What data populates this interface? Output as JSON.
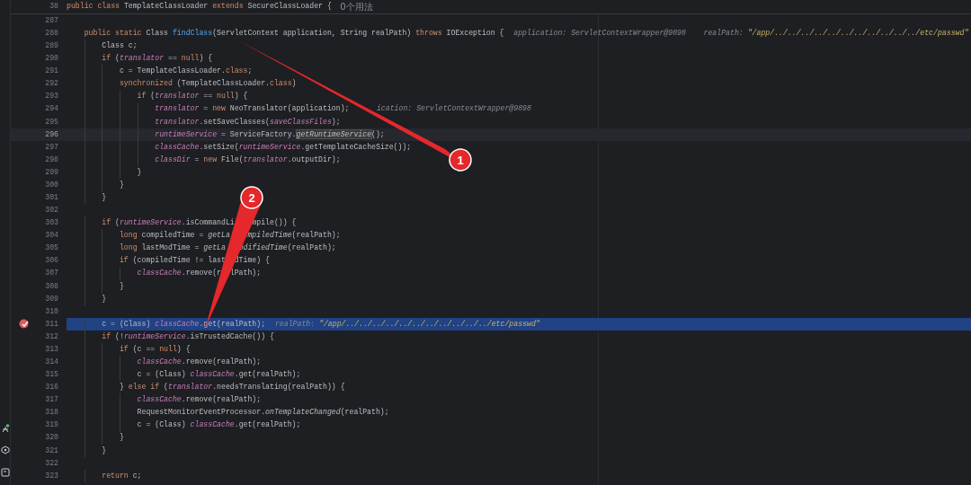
{
  "header": {
    "line": "38",
    "code": [
      {
        "kind": "keyword",
        "text": "public class "
      },
      {
        "kind": "plain",
        "text": "TemplateClassLoader "
      },
      {
        "kind": "keyword",
        "text": "extends "
      },
      {
        "kind": "plain",
        "text": "SecureClassLoader {"
      }
    ],
    "usages": "0个用法"
  },
  "lines": [
    {
      "n": "287",
      "kind": "code",
      "breakpoint": false
    },
    {
      "n": "288",
      "kind": "code",
      "breakpoint": false,
      "code": [
        {
          "kind": "keyword",
          "text": "    public static "
        },
        {
          "kind": "plain",
          "text": "Class "
        },
        {
          "kind": "declaration",
          "text": "findClass"
        },
        {
          "kind": "plain",
          "text": "(ServletContext application, String realPath) "
        },
        {
          "kind": "keyword",
          "text": "throws "
        },
        {
          "kind": "plain",
          "text": "IOException {"
        }
      ],
      "hints": [
        [
          {
            "kind": "hint",
            "text": "application: "
          },
          {
            "kind": "hint",
            "text": "ServletContextWrapper@9898"
          }
        ],
        [
          {
            "kind": "hint",
            "text": "realPath: "
          },
          {
            "kind": "hint-string",
            "text": "\"/app/../../../../../../../../../../../etc/passwd\""
          }
        ]
      ]
    },
    {
      "n": "289",
      "kind": "code",
      "breakpoint": false,
      "code": [
        {
          "kind": "plain",
          "text": "        Class c;"
        }
      ]
    },
    {
      "n": "290",
      "kind": "code",
      "breakpoint": false,
      "code": [
        {
          "kind": "keyword",
          "text": "        if "
        },
        {
          "kind": "plain",
          "text": "("
        },
        {
          "kind": "field",
          "text": "translator"
        },
        {
          "kind": "plain",
          "text": " == "
        },
        {
          "kind": "keyword",
          "text": "null"
        },
        {
          "kind": "plain",
          "text": ") {"
        }
      ]
    },
    {
      "n": "291",
      "kind": "code",
      "breakpoint": false,
      "code": [
        {
          "kind": "plain",
          "text": "            c = TemplateClassLoader."
        },
        {
          "kind": "keyword",
          "text": "class"
        },
        {
          "kind": "plain",
          "text": ";"
        }
      ]
    },
    {
      "n": "292",
      "kind": "code",
      "breakpoint": false,
      "code": [
        {
          "kind": "keyword",
          "text": "            synchronized "
        },
        {
          "kind": "plain",
          "text": "(TemplateClassLoader."
        },
        {
          "kind": "keyword",
          "text": "class"
        },
        {
          "kind": "plain",
          "text": ")"
        }
      ]
    },
    {
      "n": "293",
      "kind": "code",
      "breakpoint": false,
      "code": [
        {
          "kind": "keyword",
          "text": "                if "
        },
        {
          "kind": "plain",
          "text": "("
        },
        {
          "kind": "field",
          "text": "translator"
        },
        {
          "kind": "plain",
          "text": " == "
        },
        {
          "kind": "keyword",
          "text": "null"
        },
        {
          "kind": "plain",
          "text": ") {"
        }
      ]
    },
    {
      "n": "294",
      "kind": "code",
      "breakpoint": false,
      "code": [
        {
          "kind": "field",
          "text": "                    translator"
        },
        {
          "kind": "plain",
          "text": " = "
        },
        {
          "kind": "keyword",
          "text": "new "
        },
        {
          "kind": "plain",
          "text": "NeoTranslator(application);"
        }
      ],
      "hints": [
        [
          {
            "kind": "covered"
          },
          {
            "kind": "hint",
            "text": "ication: "
          },
          {
            "kind": "hint",
            "text": "ServletContextWrapper@9898"
          }
        ]
      ]
    },
    {
      "n": "295",
      "kind": "code",
      "breakpoint": false,
      "code": [
        {
          "kind": "field",
          "text": "                    translator"
        },
        {
          "kind": "plain",
          "text": ".setSaveClasses("
        },
        {
          "kind": "field",
          "text": "saveClassFiles"
        },
        {
          "kind": "plain",
          "text": ");"
        }
      ]
    },
    {
      "n": "296",
      "kind": "caret",
      "breakpoint": false,
      "code": [
        {
          "kind": "field",
          "text": "                    runtimeService"
        },
        {
          "kind": "plain",
          "text": " = ServiceFactory."
        },
        {
          "kind": "usage",
          "text": "getRuntimeService"
        },
        {
          "kind": "plain",
          "text": "();"
        }
      ]
    },
    {
      "n": "297",
      "kind": "code",
      "breakpoint": false,
      "code": [
        {
          "kind": "field",
          "text": "                    classCache"
        },
        {
          "kind": "plain",
          "text": ".setSize("
        },
        {
          "kind": "field",
          "text": "runtimeService"
        },
        {
          "kind": "plain",
          "text": ".getTemplateCacheSize());"
        }
      ]
    },
    {
      "n": "298",
      "kind": "code",
      "breakpoint": false,
      "code": [
        {
          "kind": "field",
          "text": "                    classDir"
        },
        {
          "kind": "plain",
          "text": " = "
        },
        {
          "kind": "keyword",
          "text": "new "
        },
        {
          "kind": "plain",
          "text": "File("
        },
        {
          "kind": "field",
          "text": "translator"
        },
        {
          "kind": "plain",
          "text": ".outputDir);"
        }
      ]
    },
    {
      "n": "299",
      "kind": "code",
      "breakpoint": false,
      "code": [
        {
          "kind": "plain",
          "text": "                }"
        }
      ]
    },
    {
      "n": "300",
      "kind": "code",
      "breakpoint": false,
      "code": [
        {
          "kind": "plain",
          "text": "            }"
        }
      ]
    },
    {
      "n": "301",
      "kind": "code",
      "breakpoint": false,
      "code": [
        {
          "kind": "plain",
          "text": "        }"
        }
      ]
    },
    {
      "n": "302",
      "kind": "code",
      "breakpoint": false
    },
    {
      "n": "303",
      "kind": "code",
      "breakpoint": false,
      "code": [
        {
          "kind": "keyword",
          "text": "        if "
        },
        {
          "kind": "plain",
          "text": "("
        },
        {
          "kind": "field",
          "text": "runtimeService"
        },
        {
          "kind": "plain",
          "text": ".isCommandLi"
        },
        {
          "kind": "covered"
        },
        {
          "kind": "plain",
          "text": "mpile()) {"
        }
      ]
    },
    {
      "n": "304",
      "kind": "code",
      "breakpoint": false,
      "code": [
        {
          "kind": "keyword",
          "text": "            long "
        },
        {
          "kind": "plain",
          "text": "compiledTime = "
        },
        {
          "kind": "static-call",
          "text": "getLa"
        },
        {
          "kind": "covered"
        },
        {
          "kind": "static-call",
          "text": "mpiledTime"
        },
        {
          "kind": "plain",
          "text": "(realPath);"
        }
      ]
    },
    {
      "n": "305",
      "kind": "code",
      "breakpoint": false,
      "code": [
        {
          "kind": "keyword",
          "text": "            long "
        },
        {
          "kind": "plain",
          "text": "lastModTime = "
        },
        {
          "kind": "static-call",
          "text": "getLa"
        },
        {
          "kind": "covered"
        },
        {
          "kind": "static-call",
          "text": "odifiedTime"
        },
        {
          "kind": "plain",
          "text": "(realPath);"
        }
      ]
    },
    {
      "n": "306",
      "kind": "code",
      "breakpoint": false,
      "code": [
        {
          "kind": "keyword",
          "text": "            if "
        },
        {
          "kind": "plain",
          "text": "(compiledTime != last"
        },
        {
          "kind": "covered"
        },
        {
          "kind": "plain",
          "text": "dTime) {"
        }
      ]
    },
    {
      "n": "307",
      "kind": "code",
      "breakpoint": false,
      "code": [
        {
          "kind": "field",
          "text": "                classCache"
        },
        {
          "kind": "plain",
          "text": ".remove(r"
        },
        {
          "kind": "covered"
        },
        {
          "kind": "plain",
          "text": "lPath);"
        }
      ]
    },
    {
      "n": "308",
      "kind": "code",
      "breakpoint": false,
      "code": [
        {
          "kind": "plain",
          "text": "            }"
        }
      ]
    },
    {
      "n": "309",
      "kind": "code",
      "breakpoint": false,
      "code": [
        {
          "kind": "plain",
          "text": "        }"
        }
      ]
    },
    {
      "n": "310",
      "kind": "code",
      "breakpoint": false
    },
    {
      "n": "311",
      "kind": "execution",
      "breakpoint": true,
      "code": [
        {
          "kind": "plain",
          "text": "        c = (Class) "
        },
        {
          "kind": "field",
          "text": "classCache"
        },
        {
          "kind": "plain",
          "text": ".get(realPath);"
        }
      ],
      "hints": [
        [
          {
            "kind": "hint",
            "text": "realPath: "
          },
          {
            "kind": "hint-string",
            "text": "\"/app/../../../../../../../../../../../etc/passwd\""
          }
        ]
      ]
    },
    {
      "n": "312",
      "kind": "code",
      "breakpoint": false,
      "code": [
        {
          "kind": "keyword",
          "text": "        if "
        },
        {
          "kind": "plain",
          "text": "(!"
        },
        {
          "kind": "field",
          "text": "runtimeService"
        },
        {
          "kind": "plain",
          "text": ".isTrustedCache()) {"
        }
      ]
    },
    {
      "n": "313",
      "kind": "code",
      "breakpoint": false,
      "code": [
        {
          "kind": "keyword",
          "text": "            if "
        },
        {
          "kind": "plain",
          "text": "(c == "
        },
        {
          "kind": "keyword",
          "text": "null"
        },
        {
          "kind": "plain",
          "text": ") {"
        }
      ]
    },
    {
      "n": "314",
      "kind": "code",
      "breakpoint": false,
      "code": [
        {
          "kind": "field",
          "text": "                classCache"
        },
        {
          "kind": "plain",
          "text": ".remove(realPath);"
        }
      ]
    },
    {
      "n": "315",
      "kind": "code",
      "breakpoint": false,
      "code": [
        {
          "kind": "plain",
          "text": "                c = (Class) "
        },
        {
          "kind": "field",
          "text": "classCache"
        },
        {
          "kind": "plain",
          "text": ".get(realPath);"
        }
      ]
    },
    {
      "n": "316",
      "kind": "code",
      "breakpoint": false,
      "code": [
        {
          "kind": "plain",
          "text": "            } "
        },
        {
          "kind": "keyword",
          "text": "else if "
        },
        {
          "kind": "plain",
          "text": "("
        },
        {
          "kind": "field",
          "text": "translator"
        },
        {
          "kind": "plain",
          "text": ".needsTranslating(realPath)) {"
        }
      ]
    },
    {
      "n": "317",
      "kind": "code",
      "breakpoint": false,
      "code": [
        {
          "kind": "field",
          "text": "                classCache"
        },
        {
          "kind": "plain",
          "text": ".remove(realPath);"
        }
      ]
    },
    {
      "n": "318",
      "kind": "code",
      "breakpoint": false,
      "code": [
        {
          "kind": "plain",
          "text": "                RequestMonitorEventProcessor."
        },
        {
          "kind": "static-call",
          "text": "onTemplateChanged"
        },
        {
          "kind": "plain",
          "text": "(realPath);"
        }
      ]
    },
    {
      "n": "319",
      "kind": "code",
      "breakpoint": false,
      "code": [
        {
          "kind": "plain",
          "text": "                c = (Class) "
        },
        {
          "kind": "field",
          "text": "classCache"
        },
        {
          "kind": "plain",
          "text": ".get(realPath);"
        }
      ]
    },
    {
      "n": "320",
      "kind": "code",
      "breakpoint": false,
      "code": [
        {
          "kind": "plain",
          "text": "            }"
        }
      ]
    },
    {
      "n": "321",
      "kind": "code",
      "breakpoint": false,
      "code": [
        {
          "kind": "plain",
          "text": "        }"
        }
      ]
    },
    {
      "n": "322",
      "kind": "code",
      "breakpoint": false
    },
    {
      "n": "323",
      "kind": "code",
      "breakpoint": false,
      "code": [
        {
          "kind": "keyword",
          "text": "        return "
        },
        {
          "kind": "plain",
          "text": "c;"
        }
      ]
    }
  ],
  "annotations": [
    {
      "number": "1"
    },
    {
      "number": "2"
    }
  ]
}
